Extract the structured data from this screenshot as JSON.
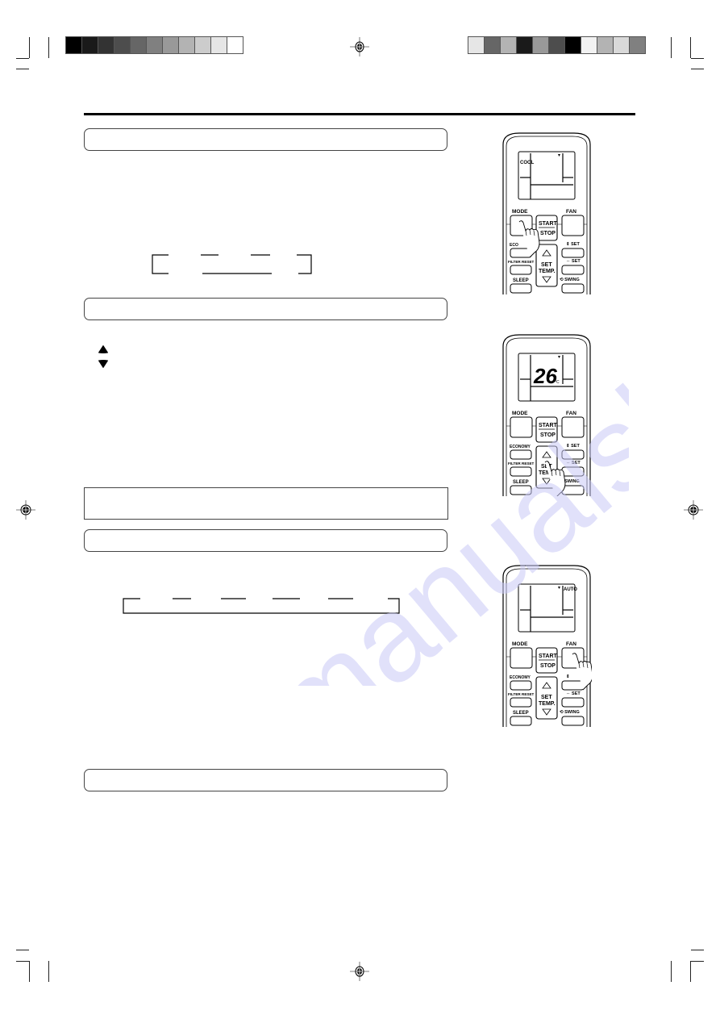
{
  "page": {
    "type": "air conditioner remote control instruction page (print proof)",
    "header_rule": true,
    "watermark_text": "manualshive"
  },
  "print_marks": {
    "left_color_bar": [
      "#000000",
      "#1a1a1a",
      "#333333",
      "#4d4d4d",
      "#666666",
      "#808080",
      "#999999",
      "#b3b3b3",
      "#cccccc",
      "#e6e6e6",
      "#ffffff"
    ],
    "right_color_bar": [
      "#e6e6e6",
      "#666666",
      "#b3b3b3",
      "#1a1a1a",
      "#999999",
      "#4d4d4d",
      "#000000",
      "#f2f2f2",
      "#b3b3b3",
      "#d9d9d9",
      "#808080"
    ]
  },
  "sections": [
    {
      "id": "mode",
      "header": "",
      "cycle_diagram": "mode-cycle"
    },
    {
      "id": "temperature",
      "header": "",
      "icons": [
        "triangle-up-icon",
        "triangle-down-icon"
      ]
    },
    {
      "id": "note",
      "text": ""
    },
    {
      "id": "fan",
      "header": "",
      "cycle_diagram": "fan-cycle"
    },
    {
      "id": "swing",
      "header": ""
    }
  ],
  "remotes": [
    {
      "id": "remote-mode",
      "display": {
        "mode_label": "COOL",
        "temperature": "",
        "unit": "",
        "fan_label": ""
      },
      "pressed_button": "MODE",
      "buttons": {
        "mode": "MODE",
        "fan": "FAN",
        "start": "START",
        "stop": "STOP",
        "economy": "ECO",
        "set_vertical": "SET",
        "filter_reset": "FILTER RESET",
        "set_horizontal": "SET",
        "set_temp_1": "SET",
        "set_temp_2": "TEMP.",
        "sleep": "SLEEP",
        "swing": "SWING"
      }
    },
    {
      "id": "remote-temp",
      "display": {
        "mode_label": "",
        "temperature": "26",
        "unit": "°C",
        "fan_label": ""
      },
      "pressed_button": "SET TEMP.",
      "buttons": {
        "mode": "MODE",
        "fan": "FAN",
        "start": "START",
        "stop": "STOP",
        "economy": "ECONOMY",
        "set_vertical": "SET",
        "filter_reset": "FILTER RESET",
        "set_horizontal": "SET",
        "set_temp_1": "SET",
        "set_temp_2": "TEMP.",
        "sleep": "SLEEP",
        "swing": "SWING"
      }
    },
    {
      "id": "remote-fan",
      "display": {
        "mode_label": "",
        "temperature": "",
        "unit": "",
        "fan_label": "AUTO"
      },
      "pressed_button": "FAN",
      "buttons": {
        "mode": "MODE",
        "fan": "FAN",
        "start": "START",
        "stop": "STOP",
        "economy": "ECONOMY",
        "set_vertical": "",
        "filter_reset": "FILTER RESET",
        "set_horizontal": "SET",
        "set_temp_1": "SET",
        "set_temp_2": "TEMP.",
        "sleep": "SLEEP",
        "swing": "SWING"
      }
    }
  ]
}
